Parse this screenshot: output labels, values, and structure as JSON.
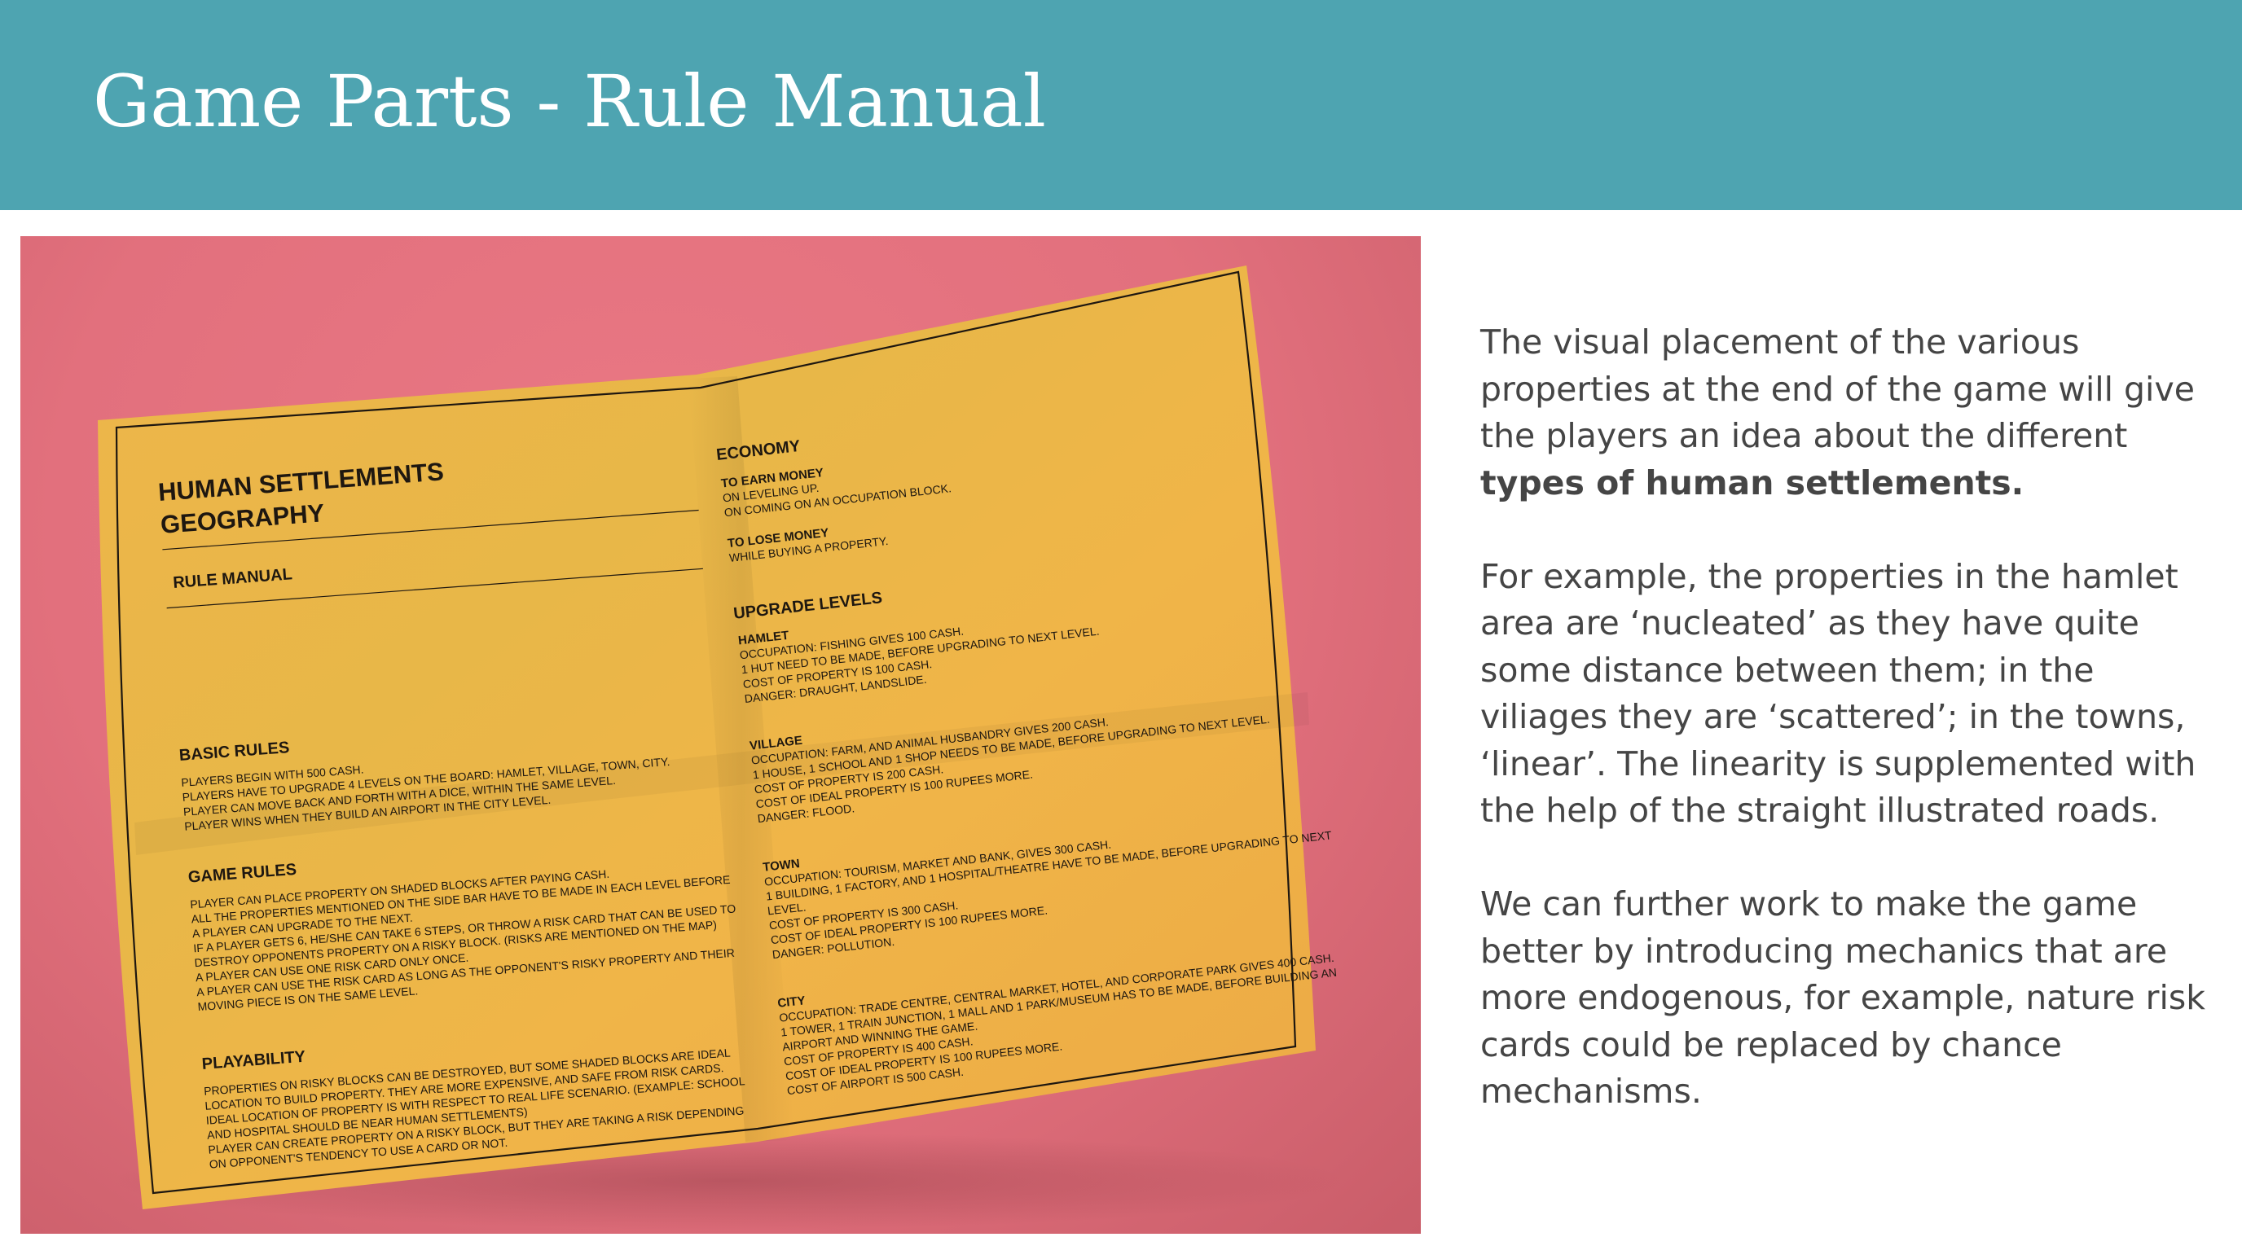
{
  "slide": {
    "title": "Game Parts - Rule Manual",
    "paragraphs": {
      "p1_pre": "The visual placement of the various properties at the end of the game will give the players an idea about the different ",
      "p1_bold": "types of human settlements.",
      "p2": "For example, the properties in the hamlet area are ‘nucleated’ as they have quite some distance between them; in the viliages they are ‘scattered’; in the towns, ‘linear’. The linearity is supplemented with the help of the straight illustrated roads.",
      "p3": "We can further work to make the game better by introducing mechanics that are more endogenous, for example, nature risk cards could be replaced by chance mechanisms."
    }
  },
  "manual": {
    "title_line1": "HUMAN SETTLEMENTS",
    "title_line2": "GEOGRAPHY",
    "subtitle": "RULE MANUAL",
    "basic_rules": {
      "heading": "BASIC RULES",
      "lines": [
        "PLAYERS BEGIN WITH 500 CASH.",
        "PLAYERS HAVE TO UPGRADE 4 LEVELS ON THE BOARD: HAMLET, VILLAGE, TOWN, CITY.",
        "PLAYER CAN MOVE BACK AND FORTH WITH A DICE, WITHIN THE SAME LEVEL.",
        "PLAYER WINS WHEN THEY BUILD AN AIRPORT IN THE CITY LEVEL."
      ]
    },
    "game_rules": {
      "heading": "GAME RULES",
      "lines": [
        "PLAYER CAN PLACE PROPERTY ON SHADED BLOCKS AFTER PAYING CASH.",
        "ALL THE PROPERTIES MENTIONED ON THE SIDE BAR HAVE TO BE MADE IN EACH LEVEL BEFORE",
        "A PLAYER CAN UPGRADE TO THE NEXT.",
        "IF A PLAYER GETS 6, HE/SHE CAN TAKE 6 STEPS, OR THROW A RISK CARD THAT CAN BE USED TO",
        "DESTROY OPPONENTS PROPERTY ON A RISKY BLOCK. (RISKS ARE MENTIONED ON THE MAP)",
        "A PLAYER CAN USE ONE RISK CARD ONLY ONCE.",
        "A PLAYER CAN USE THE RISK CARD AS LONG AS THE OPPONENT'S RISKY PROPERTY AND THEIR",
        "MOVING PIECE IS ON THE SAME LEVEL."
      ]
    },
    "playability": {
      "heading": "PLAYABILITY",
      "lines": [
        "PROPERTIES ON RISKY BLOCKS CAN BE DESTROYED, BUT SOME SHADED BLOCKS ARE IDEAL",
        "LOCATION TO BUILD PROPERTY. THEY ARE MORE EXPENSIVE, AND SAFE FROM RISK CARDS.",
        "IDEAL LOCATION OF PROPERTY IS WITH RESPECT TO REAL LIFE SCENARIO. (EXAMPLE: SCHOOL",
        "AND HOSPITAL SHOULD BE NEAR HUMAN SETTLEMENTS)",
        "PLAYER CAN CREATE PROPERTY ON A RISKY BLOCK, BUT THEY ARE TAKING A RISK DEPENDING",
        "ON OPPONENT'S TENDENCY TO USE A CARD OR NOT."
      ]
    },
    "economy": {
      "heading": "ECONOMY",
      "earn_label": "TO EARN MONEY",
      "earn_lines": [
        "ON LEVELING UP.",
        "ON COMING ON AN OCCUPATION BLOCK."
      ],
      "lose_label": "TO LOSE MONEY",
      "lose_lines": [
        "WHILE BUYING A PROPERTY."
      ]
    },
    "upgrade": {
      "heading": "UPGRADE LEVELS",
      "hamlet": {
        "label": "HAMLET",
        "lines": [
          "OCCUPATION: FISHING GIVES 100 CASH.",
          "1 HUT NEED TO BE MADE, BEFORE UPGRADING TO NEXT LEVEL.",
          "COST OF PROPERTY IS 100 CASH.",
          "DANGER: DRAUGHT, LANDSLIDE."
        ]
      },
      "village": {
        "label": "VILLAGE",
        "lines": [
          "OCCUPATION: FARM, AND ANIMAL HUSBANDRY GIVES 200 CASH.",
          "1 HOUSE, 1 SCHOOL AND 1 SHOP NEEDS TO BE MADE, BEFORE UPGRADING TO NEXT LEVEL.",
          "COST OF PROPERTY IS 200 CASH.",
          "COST OF IDEAL PROPERTY IS 100 RUPEES MORE.",
          "DANGER: FLOOD."
        ]
      },
      "town": {
        "label": "TOWN",
        "lines": [
          "OCCUPATION: TOURISM, MARKET AND BANK, GIVES 300 CASH.",
          "1 BUILDING, 1 FACTORY, AND 1 HOSPITAL/THEATRE HAVE TO BE MADE, BEFORE UPGRADING TO NEXT",
          "LEVEL.",
          "COST OF PROPERTY IS 300 CASH.",
          "COST OF IDEAL PROPERTY IS 100 RUPEES MORE.",
          "DANGER: POLLUTION."
        ]
      },
      "city": {
        "label": "CITY",
        "lines": [
          "OCCUPATION: TRADE CENTRE, CENTRAL MARKET, HOTEL, AND CORPORATE PARK GIVES 400 CASH.",
          "1 TOWER, 1 TRAIN JUNCTION, 1 MALL AND 1 PARK/MUSEUM HAS TO BE MADE, BEFORE BUILDING AN",
          "AIRPORT AND WINNING THE GAME.",
          "COST OF PROPERTY IS 400 CASH.",
          "COST OF IDEAL PROPERTY IS 100 RUPEES MORE.",
          "COST OF AIRPORT IS 500 CASH."
        ]
      }
    }
  },
  "colors": {
    "header_bg": "#4ea4b1",
    "photo_bg": "#e2707d",
    "paper": "#eeb044",
    "body_text": "#454545"
  }
}
